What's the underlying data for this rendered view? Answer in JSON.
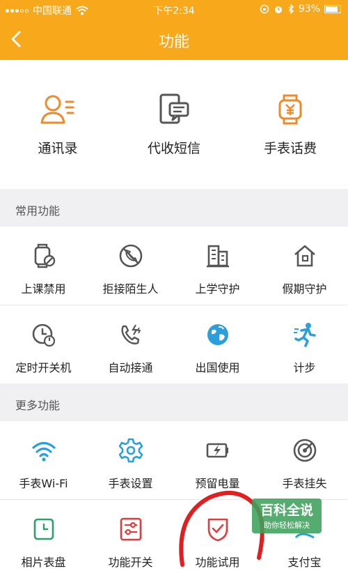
{
  "status": {
    "carrier": "中国联通",
    "time": "下午2:34",
    "battery": "93%",
    "battery_level": 0.93
  },
  "nav": {
    "title": "功能"
  },
  "top_items": [
    {
      "label": "通讯录",
      "icon": "contacts-icon"
    },
    {
      "label": "代收短信",
      "icon": "sms-icon"
    },
    {
      "label": "手表话费",
      "icon": "watch-fee-icon"
    }
  ],
  "common": {
    "title": "常用功能",
    "items": [
      {
        "label": "上课禁用",
        "icon": "class-disable-icon"
      },
      {
        "label": "拒接陌生人",
        "icon": "block-stranger-icon"
      },
      {
        "label": "上学守护",
        "icon": "school-guard-icon"
      },
      {
        "label": "假期守护",
        "icon": "holiday-guard-icon"
      },
      {
        "label": "定时开关机",
        "icon": "timer-power-icon"
      },
      {
        "label": "自动接通",
        "icon": "auto-answer-icon"
      },
      {
        "label": "出国使用",
        "icon": "abroad-icon"
      },
      {
        "label": "计步",
        "icon": "pedometer-icon"
      }
    ]
  },
  "more": {
    "title": "更多功能",
    "items": [
      {
        "label": "手表Wi-Fi",
        "icon": "wifi-icon"
      },
      {
        "label": "手表设置",
        "icon": "settings-gear-icon"
      },
      {
        "label": "预留电量",
        "icon": "battery-reserve-icon"
      },
      {
        "label": "手表挂失",
        "icon": "report-loss-icon"
      },
      {
        "label": "相片表盘",
        "icon": "photo-dial-icon"
      },
      {
        "label": "功能开关",
        "icon": "feature-switch-icon"
      },
      {
        "label": "功能试用",
        "icon": "feature-trial-icon"
      },
      {
        "label": "支付宝",
        "icon": "alipay-icon"
      }
    ]
  },
  "watermark": {
    "title": "百科全说",
    "subtitle": "助你轻松解决"
  },
  "colors": {
    "accent": "#f7a81b",
    "orange_icon": "#ee8a2a",
    "blue_icon": "#2a9fdc",
    "gray_icon": "#555555",
    "red_icon": "#e23b3b",
    "green_icon": "#2aa06a"
  }
}
